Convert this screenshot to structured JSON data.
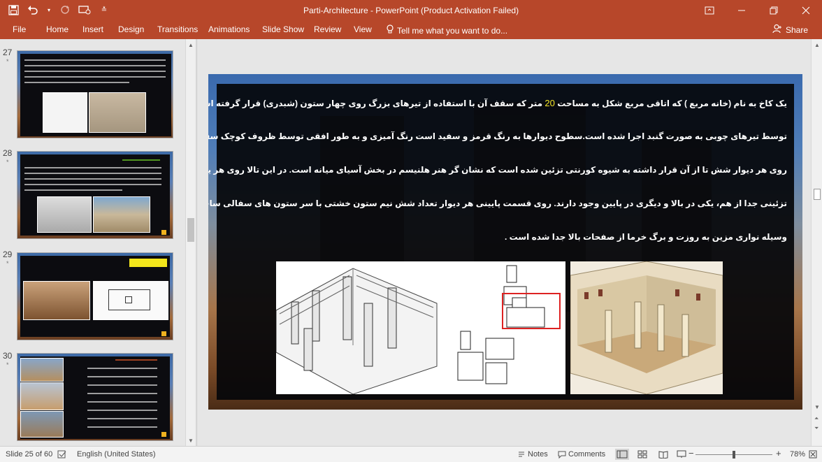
{
  "window": {
    "title": "Parti-Architecture - PowerPoint (Product Activation Failed)",
    "qat_icons": [
      "save-icon",
      "undo-icon",
      "undo-dropdown-icon",
      "redo-icon",
      "present-icon",
      "customize-icon"
    ],
    "controls": [
      "ribbon-display-icon",
      "minimize-icon",
      "restore-icon",
      "close-icon"
    ]
  },
  "ribbon": {
    "tabs": [
      "File",
      "Home",
      "Insert",
      "Design",
      "Transitions",
      "Animations",
      "Slide Show",
      "Review",
      "View"
    ],
    "tellme": "Tell me what you want to do...",
    "share": "Share"
  },
  "thumbnails": [
    {
      "number": "27",
      "star": "*"
    },
    {
      "number": "28",
      "star": "*"
    },
    {
      "number": "29",
      "star": "*"
    },
    {
      "number": "30",
      "star": "*"
    }
  ],
  "slide": {
    "lines": [
      [
        "یک کاخ به نام (خانه مربع ) که اتاقی مربع شکل به مساحت ",
        "20",
        " متر که سقف آن با استفاده از تیرهای بزرگ روی چهار ستون (شبدری) قرار گرفته است بخش های مرکزی"
      ],
      [
        "توسط تیرهای چوبی به صورت گنبد اجرا شده است.سطوح دیوارها به رنگ قرمز و سفید است رنگ آمیزی و به طور افقی توسط ظروف کوچک سفالی با نیم ستون ها که",
        "",
        ""
      ],
      [
        "روی هر دیوار شش تا از آن قرار داشته به شیوه کورنتی تزئین شده است  که نشان گر هنر هلنیسم در بخش آسیای میانه است. در این تالا روی هر یک از چهار دیوار دو بخش",
        "",
        ""
      ],
      [
        "تزئینی جدا از هم، یکی در بالا و دیگری در پایین وجود دارند. روی قسمت پایینی هر دیوار تعداد شش نیم ستون خشتی با سر ستون های سفالی ساخته شده و این دو بخش به",
        "",
        ""
      ],
      [
        "وسیله نواری مزین به روزت و برگ خرما از صفحات بالا جدا شده است .",
        "",
        ""
      ]
    ]
  },
  "status": {
    "slide_of": "Slide 25 of 60",
    "language": "English (United States)",
    "notes": "Notes",
    "comments": "Comments",
    "zoom": "78%"
  }
}
